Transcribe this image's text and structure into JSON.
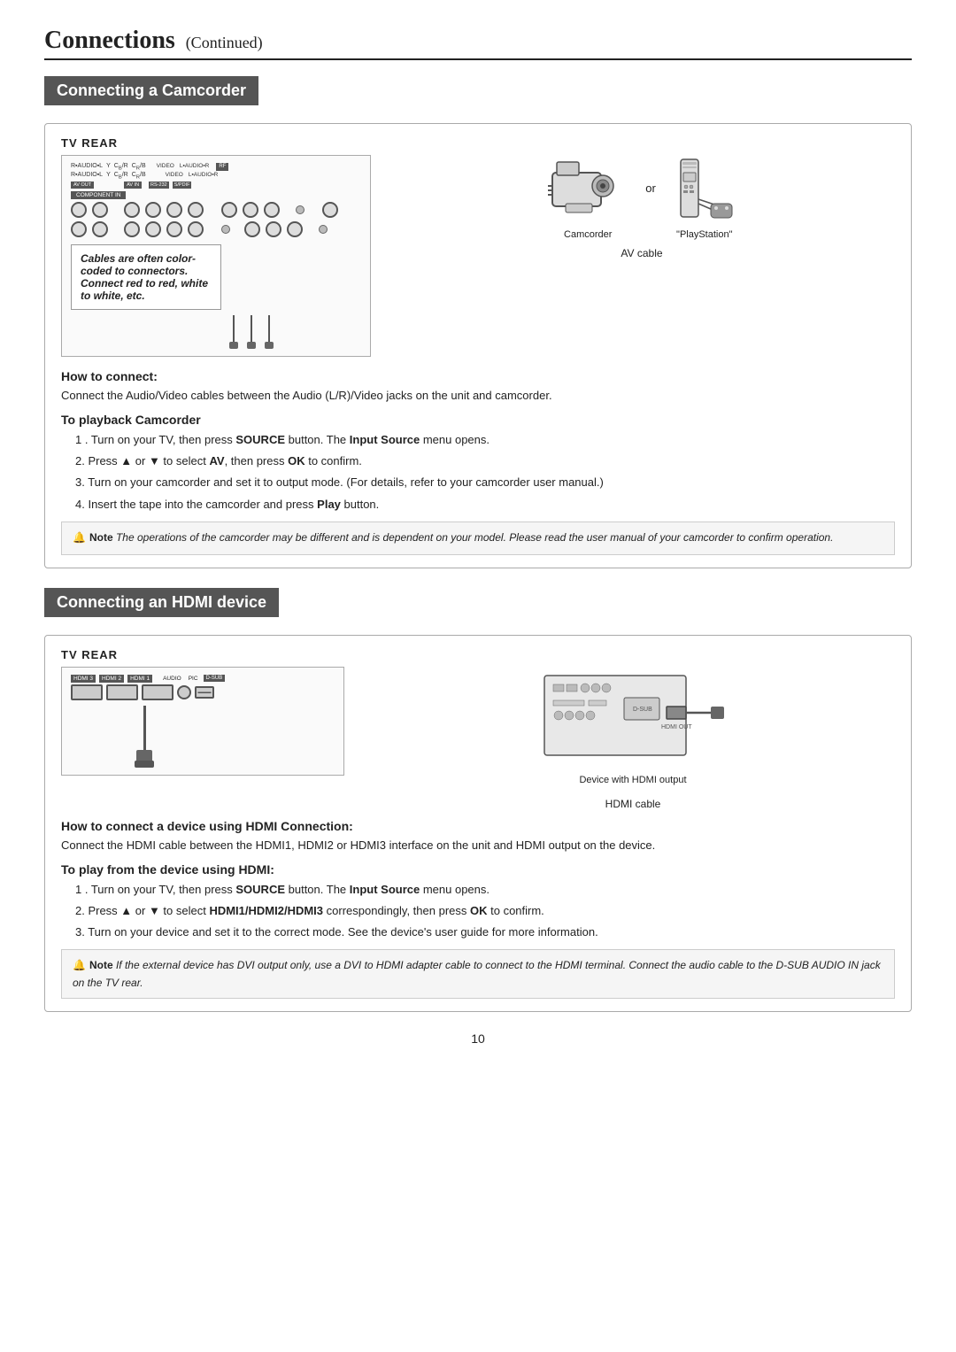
{
  "page": {
    "title": "Connections",
    "title_continued": "(Continued)",
    "page_number": "10"
  },
  "section1": {
    "header": "Connecting a Camcorder",
    "tv_rear_label": "TV REAR",
    "cable_note": "Cables are often color-coded to connectors. Connect red to red, white to white, etc.",
    "av_cable_label": "AV cable",
    "camcorder_label": "Camcorder",
    "or_label": "or",
    "playstation_label": "\"PlayStation\"",
    "how_to_connect_title": "How to connect:",
    "how_to_connect_text": "Connect the Audio/Video cables between the Audio (L/R)/Video jacks on the unit and camcorder.",
    "playback_title": "To playback Camcorder",
    "steps": [
      "1 . Turn on your TV,  then press SOURCE button. The Input Source menu opens.",
      "2. Press ▲ or ▼ to select AV, then press OK to confirm.",
      "3. Turn on your camcorder and set it to output mode. (For details, refer to your camcorder user manual.)",
      "4. Insert the tape into the camcorder and press Play button."
    ],
    "note_label": "Note",
    "note_text": "The operations of the camcorder may be different and is dependent on your model. Please read the user manual of your camcorder to confirm operation."
  },
  "section2": {
    "header": "Connecting an HDMI device",
    "tv_rear_label": "TV REAR",
    "hdmi_labels": [
      "HDMI 3",
      "HDMI 2",
      "HDMI 1"
    ],
    "audio_label": "AUDIO",
    "pic_label": "PIC",
    "dsub_label": "D-SUB",
    "hdmi_cable_label": "HDMI cable",
    "device_label": "Device with HDMI output",
    "how_to_connect_title": "How to connect a device using HDMI Connection:",
    "how_to_connect_text": "Connect the HDMI cable between the HDMI1, HDMI2 or HDMI3 interface on the unit and HDMI output on the device.",
    "play_title": "To play from the device using HDMI:",
    "play_steps": [
      "1 . Turn on your TV,  then press SOURCE button. The Input Source menu opens.",
      "2. Press ▲ or ▼ to select HDMI1/HDMI2/HDMI3 correspondingly, then press OK to confirm.",
      "3. Turn on your device and set it to the correct mode. See the device's user guide for more information."
    ],
    "note_label": "Note",
    "note_text": "If the external device has DVI output only, use a DVI to HDMI adapter cable to connect to the HDMI terminal. Connect the audio cable to the D-SUB AUDIO IN jack on the TV rear."
  }
}
